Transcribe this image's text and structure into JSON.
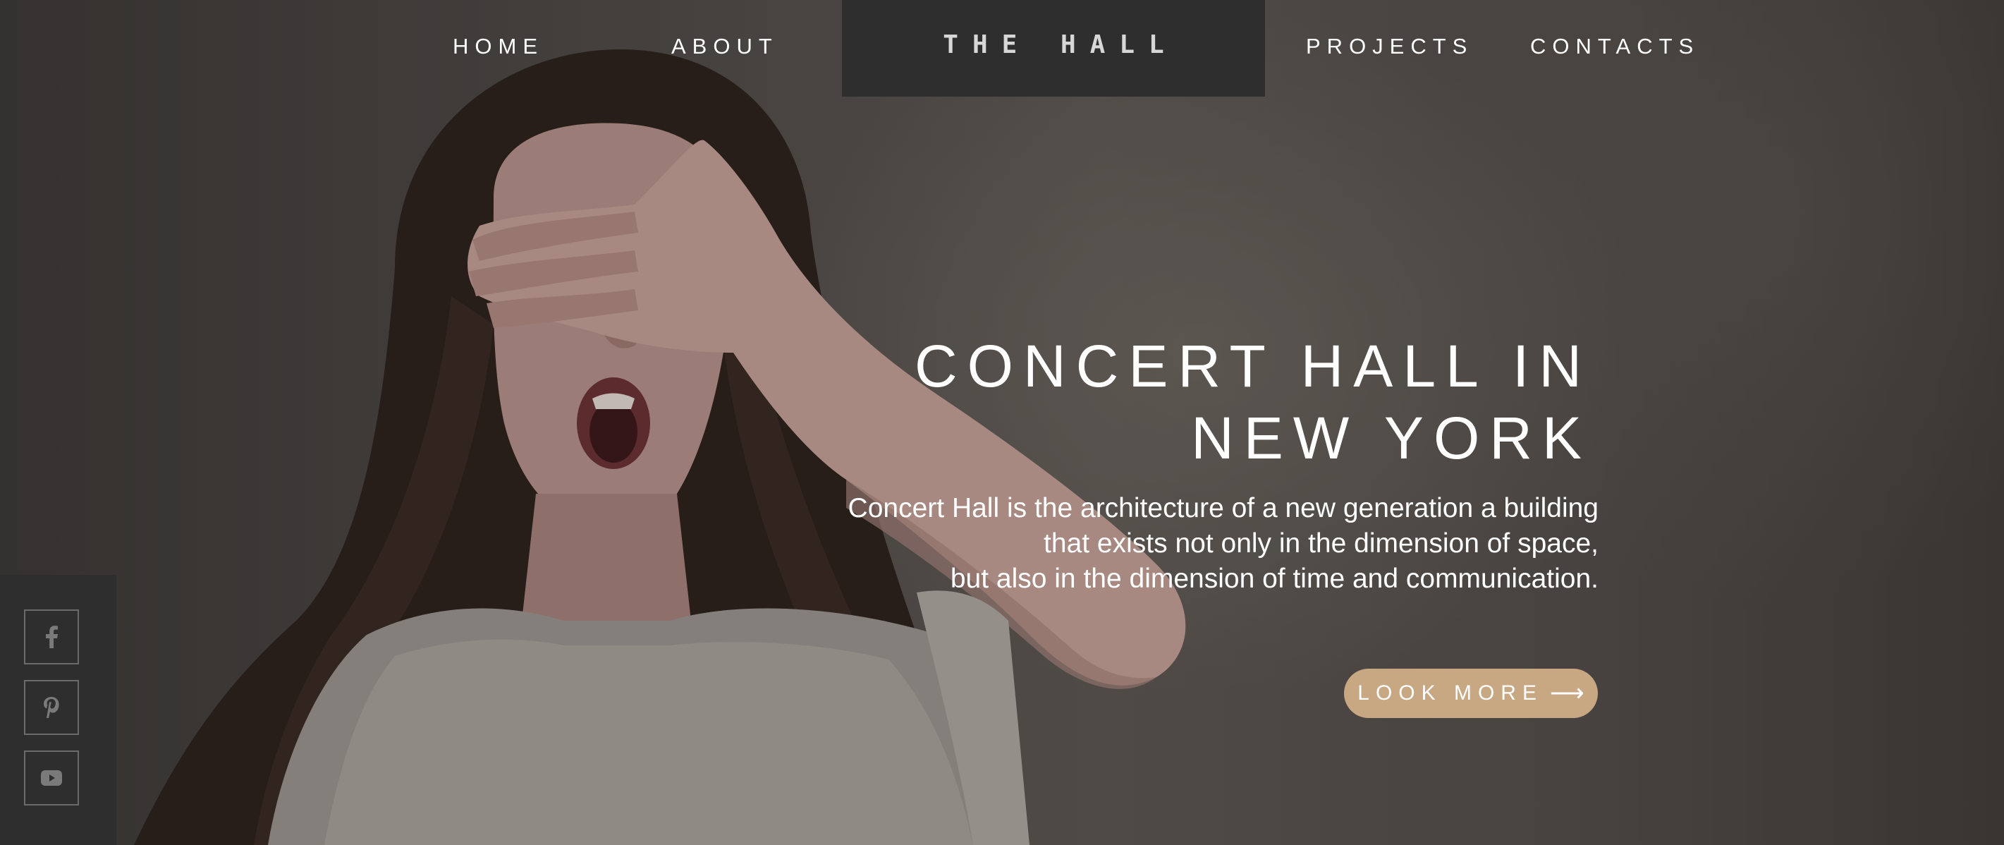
{
  "nav": {
    "items": [
      {
        "label": "HOME"
      },
      {
        "label": "ABOUT"
      },
      {
        "label": "PROJECTS"
      },
      {
        "label": "CONTACTS"
      }
    ],
    "logo": "THE HALL"
  },
  "hero": {
    "title_lines": [
      "CONCERT HALL IN",
      "NEW YORK"
    ],
    "description_lines": [
      "Concert Hall is the architecture of a new generation a building",
      "that exists not only in the dimension of space,",
      "but also in the dimension of time and communication."
    ],
    "cta_label": "LOOK MORE",
    "cta_arrow": "⟶"
  },
  "social": {
    "items": [
      {
        "icon": "facebook-icon"
      },
      {
        "icon": "pinterest-icon"
      },
      {
        "icon": "youtube-icon"
      }
    ]
  },
  "colors": {
    "accent": "#c8a783",
    "dark_panel": "#2e2e2e",
    "text": "#ffffff"
  }
}
